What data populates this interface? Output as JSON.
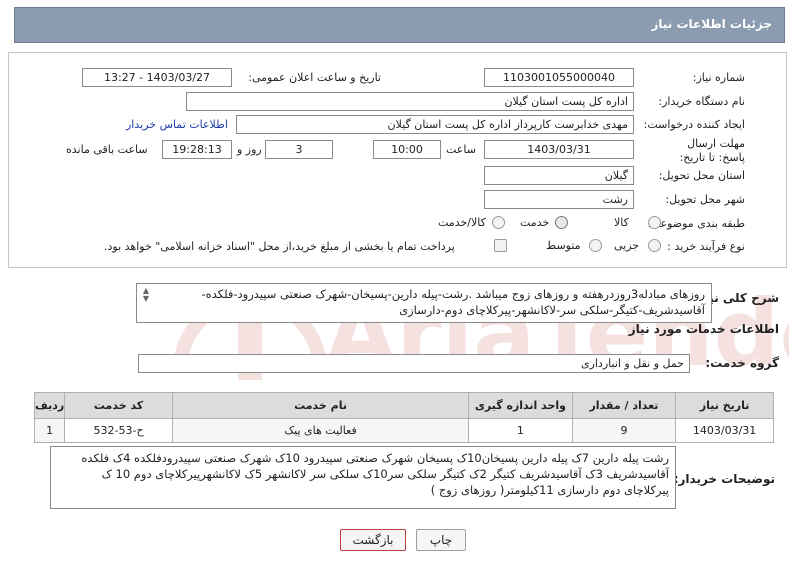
{
  "header": {
    "title": "جزئیات اطلاعات نیاز"
  },
  "form": {
    "need_number_label": "شماره نیاز:",
    "need_number": "1103001055000040",
    "announce_datetime_label": "تاریخ و ساعت اعلان عمومی:",
    "announce_datetime": "1403/03/27 - 13:27",
    "buyer_org_label": "نام دستگاه خریدار:",
    "buyer_org": "اداره کل پست استان گیلان",
    "requester_label": "ایجاد کننده درخواست:",
    "requester": "مهدی  خدابرست  کارپرداز  اداره کل پست استان گیلان",
    "contact_link": "اطلاعات تماس خریدار",
    "deadline_label": "مهلت ارسال پاسخ: تا تاریخ:",
    "deadline_date": "1403/03/31",
    "time_label": "ساعت",
    "deadline_time": "10:00",
    "days_value": "3",
    "days_label": "روز و",
    "remaining_time": "19:28:13",
    "remaining_label": "ساعت باقی مانده",
    "province_label": "استان محل تحویل:",
    "province": "گیلان",
    "city_label": "شهر محل تحویل:",
    "city": "رشت",
    "category_label": "طبقه بندی موضوعی:",
    "category_options": [
      "کالا",
      "خدمت",
      "کالا/خدمت"
    ],
    "category_selected": "خدمت",
    "process_label": "نوع فرآیند خرید :",
    "process_options": [
      "جزیی",
      "متوسط"
    ],
    "process_selected": "جزیی",
    "payment_note": "پرداخت تمام یا بخشی از مبلغ خرید،از محل \"اسناد خزانه اسلامی\" خواهد بود."
  },
  "summary": {
    "label": "شرح کلی نیاز:",
    "text": "روزهای مبادله3روزدرهفته و روزهای زوج میباشد .رشت-پیله دارین-پسیخان-شهرک صنعتی سپیدرود-فلکده-آقاسیدشریف-کتیگر-سلکی سر-لاکانشهر-پیرکلاچای دوم-دارسازی"
  },
  "services": {
    "section_title": "اطلاعات خدمات مورد نیاز",
    "group_label": "گروه خدمت:",
    "group_value": "حمل و نقل و انبارداری",
    "columns": [
      "ردیف",
      "کد خدمت",
      "نام خدمت",
      "واحد اندازه گیری",
      "تعداد / مقدار",
      "تاریخ نیاز"
    ],
    "rows": [
      {
        "row": "1",
        "code": "ح-53-532",
        "name": "فعالیت های پیک",
        "unit": "1",
        "qty": "9",
        "date": "1403/03/31"
      }
    ]
  },
  "buyer_notes": {
    "label": "توضیحات خریدار:",
    "text": "رشت پیله دارین 7ک پیله دارین پسیخان10ک پسیخان شهرک صنعتی سپیدرود 10ک شهرک صنعتی سپیدرودفلکده 4ک فلکده آقاسیدشریف 3ک آقاسیدشریف کتیگر 2ک کتیگر سلکی سر10ک سلکی سر لاکانشهر 5ک لاکانشهرپیرکلاچای دوم 10 ک پیرکلاچای دوم دارسازی 11کیلومتر( روزهای زوج )"
  },
  "buttons": {
    "print": "چاپ",
    "back": "بازگشت"
  },
  "watermark": {
    "text": "AriaTender.net"
  },
  "colors": {
    "title_bg": "#8b9bb0",
    "link": "#1a3ea8",
    "watermark": "#c0392b"
  }
}
